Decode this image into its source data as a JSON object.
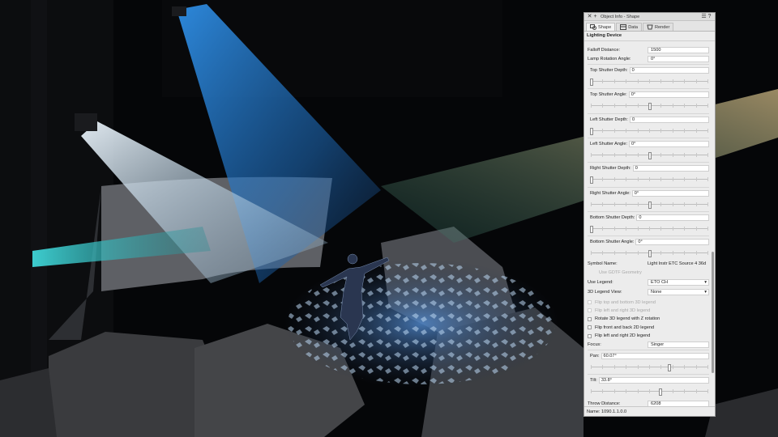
{
  "window": {
    "title": "Object Info - Shape",
    "close_glyph": "✕",
    "add_glyph": "+",
    "menu_glyph": "☰",
    "help_glyph": "?"
  },
  "tabs": [
    {
      "label": "Shape",
      "icon": "shape-icon",
      "active": true
    },
    {
      "label": "Data",
      "icon": "data-icon",
      "active": false
    },
    {
      "label": "Render",
      "icon": "render-icon",
      "active": false
    }
  ],
  "section_title": "Lighting Device",
  "fields": {
    "falloff_distance": {
      "label": "Falloff Distance:",
      "value": "1500"
    },
    "lamp_rotation": {
      "label": "Lamp Rotation Angle:",
      "value": "0°"
    }
  },
  "sliders": [
    {
      "label": "Top Shutter Depth:",
      "value": "0",
      "level": 0.0
    },
    {
      "label": "Top Shutter Angle:",
      "value": "0°",
      "level": 0.5
    },
    {
      "label": "Left Shutter Depth:",
      "value": "0",
      "level": 0.0
    },
    {
      "label": "Left Shutter Angle:",
      "value": "0°",
      "level": 0.5
    },
    {
      "label": "Right Shutter Depth:",
      "value": "0",
      "level": 0.0
    },
    {
      "label": "Right Shutter Angle:",
      "value": "0°",
      "level": 0.5
    },
    {
      "label": "Bottom Shutter Depth:",
      "value": "0",
      "level": 0.0
    },
    {
      "label": "Bottom Shutter Angle:",
      "value": "0°",
      "level": 0.5
    }
  ],
  "symbol": {
    "label": "Symbol Name:",
    "value": "Light Instr ETC Source 4 36d"
  },
  "use_gdtf": {
    "label": "Use GDTF Geometry",
    "enabled": false
  },
  "use_legend": {
    "label": "Use Legend:",
    "value": "ETO CH"
  },
  "legend_3d_view": {
    "label": "3D Legend View:",
    "value": "None"
  },
  "checkboxes": [
    {
      "label": "Flip top and bottom 3D legend",
      "enabled": false
    },
    {
      "label": "Flip left and right 3D legend",
      "enabled": false
    },
    {
      "label": "Rotate 3D legend with Z rotation",
      "enabled": true
    },
    {
      "label": "Flip front and back 2D legend",
      "enabled": true
    },
    {
      "label": "Flip left and right 2D legend",
      "enabled": true
    }
  ],
  "focus": {
    "label": "Focus:",
    "value": "Singer"
  },
  "pan": {
    "label": "Pan:",
    "value": "60.07°",
    "level": 0.67
  },
  "tilt": {
    "label": "Tilt:",
    "value": "33.8°",
    "level": 0.59
  },
  "throw_distance": {
    "label": "Throw Distance:",
    "value": "6208"
  },
  "footer": {
    "label": "Name:",
    "value": "1090.1.1.0.0"
  },
  "colors": {
    "beam_blue": "#2f8fe6",
    "beam_cyan": "#3fd6d8",
    "beam_white": "#d8e8f4",
    "beam_amber": "#d9c089",
    "background": "#050608"
  }
}
